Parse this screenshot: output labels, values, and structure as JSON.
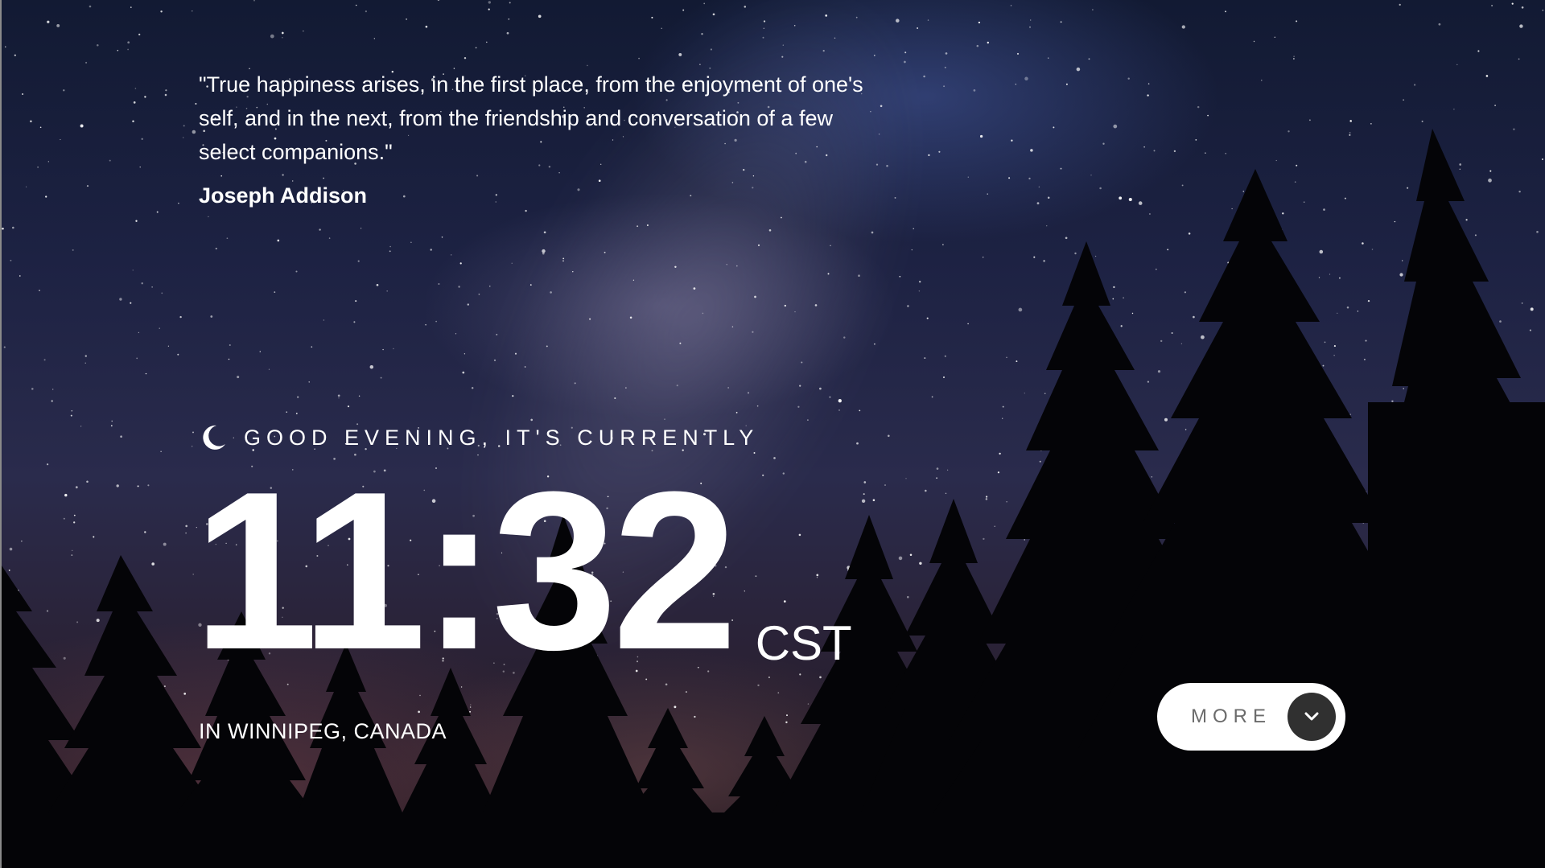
{
  "quote": {
    "text": "\"True happiness arises, in the first place, from the enjoyment of one's self, and in the next, from the friendship and conversation of a few select companions.\"",
    "author": "Joseph Addison"
  },
  "greeting": {
    "icon": "moon-icon",
    "text": "GOOD EVENING, IT'S CURRENTLY"
  },
  "clock": {
    "time": "11:32",
    "timezone": "CST"
  },
  "location": {
    "text": "IN WINNIPEG, CANADA"
  },
  "more_button": {
    "label": "MORE",
    "icon": "chevron-down-icon"
  },
  "colors": {
    "text": "#ffffff",
    "button_bg": "#ffffff",
    "button_label": "#6b6b6b",
    "chevron_bg": "#303030"
  }
}
